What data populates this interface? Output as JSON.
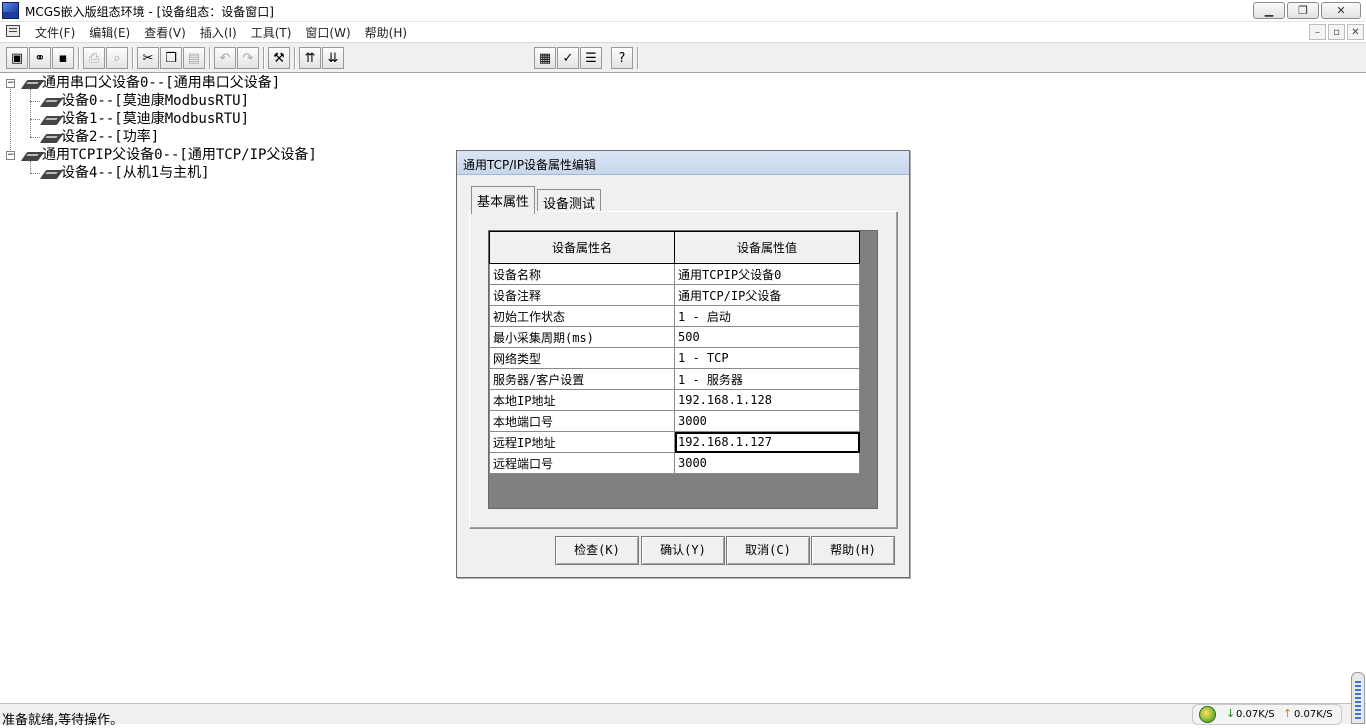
{
  "window": {
    "title": "MCGS嵌入版组态环境 - [设备组态：设备窗口]",
    "controls": [
      "▁",
      "❐",
      "✕"
    ],
    "mdi_controls": [
      "–",
      "▫",
      "✕"
    ]
  },
  "menu": {
    "items": [
      "文件(F)",
      "编辑(E)",
      "查看(V)",
      "插入(I)",
      "工具(T)",
      "窗口(W)",
      "帮助(H)"
    ]
  },
  "toolbar": {
    "buttons": [
      "new-window-icon",
      "binoculars-icon",
      "save-icon",
      "print-icon",
      "print-preview-icon",
      "cut-icon",
      "copy-icon",
      "paste-icon",
      "undo-icon",
      "redo-icon",
      "tools-icon",
      "device-up-icon",
      "device-down-icon",
      "properties-icon",
      "check-icon",
      "list-icon",
      "help-icon"
    ]
  },
  "tree": {
    "nodes": [
      {
        "label": "通用串口父设备0--[通用串口父设备]"
      },
      {
        "label": "设备0--[莫迪康ModbusRTU]"
      },
      {
        "label": "设备1--[莫迪康ModbusRTU]"
      },
      {
        "label": "设备2--[功率]"
      },
      {
        "label": "通用TCPIP父设备0--[通用TCP/IP父设备]"
      },
      {
        "label": "设备4--[从机1与主机]"
      }
    ],
    "expander_symbol": "−"
  },
  "dialog": {
    "title": "通用TCP/IP设备属性编辑",
    "tabs": [
      "基本属性",
      "设备测试"
    ],
    "columns": [
      "设备属性名",
      "设备属性值"
    ],
    "rows": [
      {
        "name": "设备名称",
        "value": "通用TCPIP父设备0"
      },
      {
        "name": "设备注释",
        "value": "通用TCP/IP父设备"
      },
      {
        "name": "初始工作状态",
        "value": "1 - 启动"
      },
      {
        "name": "最小采集周期(ms)",
        "value": "500"
      },
      {
        "name": "网络类型",
        "value": "1 - TCP"
      },
      {
        "name": "服务器/客户设置",
        "value": "1 - 服务器"
      },
      {
        "name": "本地IP地址",
        "value": "192.168.1.128"
      },
      {
        "name": "本地端口号",
        "value": "3000"
      },
      {
        "name": "远程IP地址",
        "value": "192.168.1.127"
      },
      {
        "name": "远程端口号",
        "value": "3000"
      }
    ],
    "buttons": {
      "check": "检查(K)",
      "ok": "确认(Y)",
      "cancel": "取消(C)",
      "help": "帮助(H)"
    }
  },
  "status": {
    "text": "准备就绪,等待操作。",
    "net_down_arrow": "↓",
    "net_down": "0.07K/S",
    "net_up_arrow": "↑",
    "net_up": "0.07K/S"
  }
}
